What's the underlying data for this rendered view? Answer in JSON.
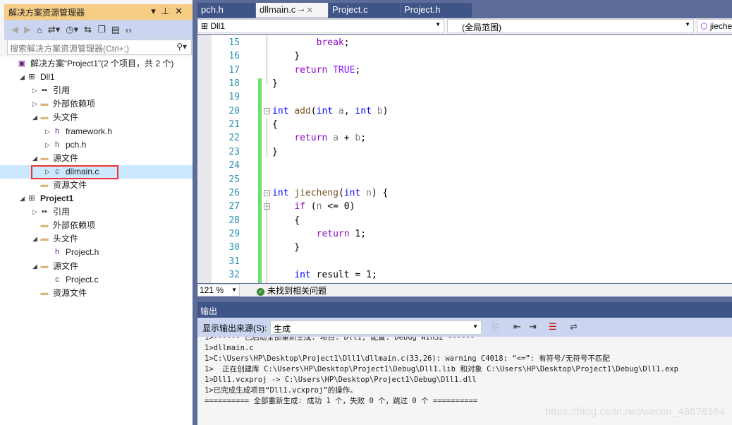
{
  "solution_explorer": {
    "title": "解决方案资源管理器",
    "title_buttons": [
      "▾",
      "⊥",
      "✕"
    ],
    "search_placeholder": "搜索解决方案资源管理器(Ctrl+;)",
    "tree": [
      {
        "label": "解决方案“Project1”(2 个项目，共 2 个)",
        "level": 0,
        "state": "none",
        "icon": "solution-icon"
      },
      {
        "label": "Dll1",
        "level": 1,
        "state": "expanded",
        "icon": "project-icon"
      },
      {
        "label": "引用",
        "level": 2,
        "state": "collapsed",
        "icon": "references-icon"
      },
      {
        "label": "外部依赖项",
        "level": 2,
        "state": "collapsed",
        "icon": "folder-icon"
      },
      {
        "label": "头文件",
        "level": 2,
        "state": "expanded",
        "icon": "folder-icon"
      },
      {
        "label": "framework.h",
        "level": 3,
        "state": "collapsed",
        "icon": "header-file-icon"
      },
      {
        "label": "pch.h",
        "level": 3,
        "state": "collapsed",
        "icon": "header-file-icon"
      },
      {
        "label": "源文件",
        "level": 2,
        "state": "expanded",
        "icon": "folder-icon"
      },
      {
        "label": "dllmain.c",
        "level": 3,
        "state": "collapsed",
        "icon": "c-file-icon",
        "selected": true
      },
      {
        "label": "资源文件",
        "level": 2,
        "state": "none",
        "icon": "folder-icon"
      },
      {
        "label": "Project1",
        "level": 1,
        "state": "expanded",
        "icon": "project-icon",
        "bold": true
      },
      {
        "label": "引用",
        "level": 2,
        "state": "collapsed",
        "icon": "references-icon"
      },
      {
        "label": "外部依赖项",
        "level": 2,
        "state": "none",
        "icon": "folder-icon"
      },
      {
        "label": "头文件",
        "level": 2,
        "state": "expanded",
        "icon": "folder-icon"
      },
      {
        "label": "Project.h",
        "level": 3,
        "state": "none",
        "icon": "header-file-icon"
      },
      {
        "label": "源文件",
        "level": 2,
        "state": "expanded",
        "icon": "folder-icon"
      },
      {
        "label": "Project.c",
        "level": 3,
        "state": "none",
        "icon": "c-file-icon"
      },
      {
        "label": "资源文件",
        "level": 2,
        "state": "none",
        "icon": "folder-icon"
      }
    ]
  },
  "tabs": [
    {
      "label": "pch.h"
    },
    {
      "label": "dllmain.c",
      "active": true
    },
    {
      "label": "Project.c"
    },
    {
      "label": "Project.h"
    }
  ],
  "navbar": {
    "project": "Dll1",
    "scope": "(全局范围)",
    "member": "jieche"
  },
  "code": [
    {
      "n": "15",
      "t": [
        [
          "        ",
          ""
        ],
        [
          "break",
          "ctl"
        ],
        [
          ";",
          ""
        ]
      ]
    },
    {
      "n": "16",
      "t": [
        [
          "    }",
          ""
        ]
      ]
    },
    {
      "n": "17",
      "t": [
        [
          "    ",
          ""
        ],
        [
          "return",
          "ctl"
        ],
        [
          " ",
          ""
        ],
        [
          "TRUE",
          "mac"
        ],
        [
          ";",
          ""
        ]
      ]
    },
    {
      "n": "18",
      "t": [
        [
          "}",
          ""
        ]
      ]
    },
    {
      "n": "19",
      "t": []
    },
    {
      "n": "20",
      "t": [
        [
          "int",
          "kw"
        ],
        [
          " ",
          ""
        ],
        [
          "add",
          "fn"
        ],
        [
          "(",
          ""
        ],
        [
          "int",
          "kw"
        ],
        [
          " ",
          ""
        ],
        [
          "a",
          "par"
        ],
        [
          ", ",
          ""
        ],
        [
          "int",
          "kw"
        ],
        [
          " ",
          ""
        ],
        [
          "b",
          "par"
        ],
        [
          ")",
          ""
        ]
      ],
      "fold": true
    },
    {
      "n": "21",
      "t": [
        [
          "{",
          ""
        ]
      ]
    },
    {
      "n": "22",
      "t": [
        [
          "    ",
          ""
        ],
        [
          "return",
          "ctl"
        ],
        [
          " ",
          ""
        ],
        [
          "a",
          "par"
        ],
        [
          " + ",
          ""
        ],
        [
          "b",
          "par"
        ],
        [
          ";",
          ""
        ]
      ]
    },
    {
      "n": "23",
      "t": [
        [
          "}",
          ""
        ]
      ]
    },
    {
      "n": "24",
      "t": []
    },
    {
      "n": "25",
      "t": []
    },
    {
      "n": "26",
      "t": [
        [
          "int",
          "kw"
        ],
        [
          " ",
          ""
        ],
        [
          "jiecheng",
          "fn"
        ],
        [
          "(",
          ""
        ],
        [
          "int",
          "kw"
        ],
        [
          " ",
          ""
        ],
        [
          "n",
          "par"
        ],
        [
          ") {",
          ""
        ]
      ],
      "fold": true
    },
    {
      "n": "27",
      "t": [
        [
          "    ",
          ""
        ],
        [
          "if",
          "ctl"
        ],
        [
          " (",
          ""
        ],
        [
          "n",
          "par"
        ],
        [
          " <= 0)",
          ""
        ]
      ],
      "fold": true
    },
    {
      "n": "28",
      "t": [
        [
          "    {",
          ""
        ]
      ]
    },
    {
      "n": "29",
      "t": [
        [
          "        ",
          ""
        ],
        [
          "return",
          "ctl"
        ],
        [
          " 1;",
          ""
        ]
      ]
    },
    {
      "n": "30",
      "t": [
        [
          "    }",
          ""
        ]
      ]
    },
    {
      "n": "31",
      "t": []
    },
    {
      "n": "32",
      "t": [
        [
          "    ",
          ""
        ],
        [
          "int",
          "kw"
        ],
        [
          " result = 1;",
          ""
        ]
      ]
    }
  ],
  "status": {
    "zoom": "121 %",
    "issues": "未找到相关问题"
  },
  "output": {
    "title": "输出",
    "source_label": "显示输出来源(S):",
    "source_value": "生成",
    "lines": [
      "1>------ 已启动全部重新生成: 项目: Dll1, 配置: Debug Win32 ------",
      "1>dllmain.c",
      "1>C:\\Users\\HP\\Desktop\\Project1\\Dll1\\dllmain.c(33,26): warning C4018: “<=”: 有符号/无符号不匹配",
      "1>  正在创建库 C:\\Users\\HP\\Desktop\\Project1\\Debug\\Dll1.lib 和对象 C:\\Users\\HP\\Desktop\\Project1\\Debug\\Dll1.exp",
      "1>Dll1.vcxproj -> C:\\Users\\HP\\Desktop\\Project1\\Debug\\Dll1.dll",
      "1>已完成生成项目“Dll1.vcxproj”的操作。",
      "========== 全部重新生成: 成功 1 个，失败 0 个，跳过 0 个 =========="
    ]
  },
  "watermark": "https://blog.csdn.net/weixin_48678164",
  "colors": {
    "accent": "#3f5487",
    "title_active": "#f5cc84",
    "selection": "#cce8ff",
    "changed_bar": "#6ce26c"
  }
}
